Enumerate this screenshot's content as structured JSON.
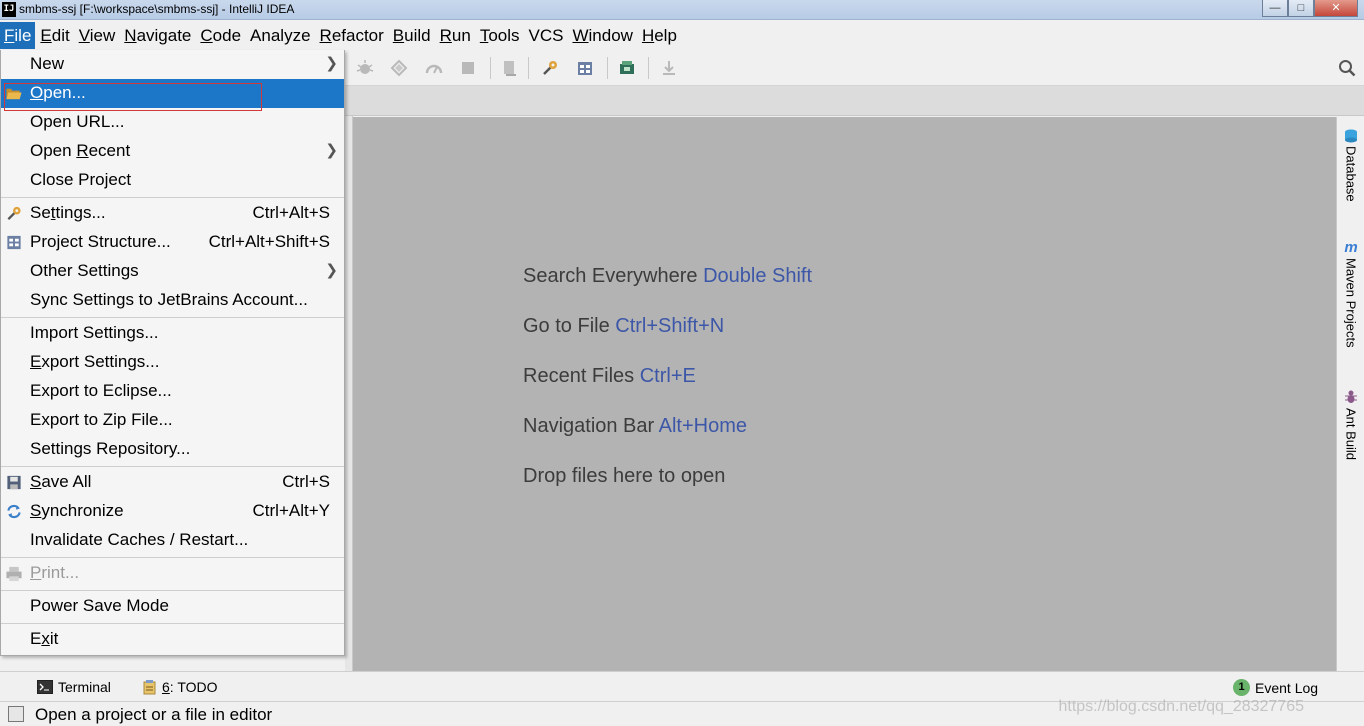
{
  "window": {
    "title": "smbms-ssj [F:\\workspace\\smbms-ssj] - IntelliJ IDEA",
    "app_icon": "IJ",
    "buttons": {
      "minimize": "—",
      "maximize": "□",
      "close": "✕"
    }
  },
  "menubar": [
    {
      "label": "File",
      "mn": "F",
      "rest": "ile",
      "active": true
    },
    {
      "label": "Edit",
      "mn": "E",
      "rest": "dit"
    },
    {
      "label": "View",
      "mn": "V",
      "rest": "iew"
    },
    {
      "label": "Navigate",
      "mn": "N",
      "rest": "avigate"
    },
    {
      "label": "Code",
      "mn": "C",
      "rest": "ode"
    },
    {
      "label": "Analyze",
      "mn": "",
      "rest": "Analyze"
    },
    {
      "label": "Refactor",
      "mn": "R",
      "rest": "efactor"
    },
    {
      "label": "Build",
      "mn": "B",
      "rest": "uild"
    },
    {
      "label": "Run",
      "mn": "R",
      "rest": "un"
    },
    {
      "label": "Tools",
      "mn": "T",
      "rest": "ools"
    },
    {
      "label": "VCS",
      "mn": "",
      "rest": "VCS"
    },
    {
      "label": "Window",
      "mn": "W",
      "rest": "indow"
    },
    {
      "label": "Help",
      "mn": "H",
      "rest": "elp"
    }
  ],
  "file_menu": {
    "items": [
      {
        "label": "New",
        "submenu": true
      },
      {
        "label": "Open...",
        "selected": true,
        "icon": "folder-open-icon"
      },
      {
        "label": "Open URL..."
      },
      {
        "label": "Open Recent",
        "submenu": true
      },
      {
        "label": "Close Project"
      },
      {
        "label": "Settings...",
        "shortcut": "Ctrl+Alt+S",
        "icon": "wrench-icon"
      },
      {
        "label": "Project Structure...",
        "shortcut": "Ctrl+Alt+Shift+S",
        "icon": "project-structure-icon"
      },
      {
        "label": "Other Settings",
        "submenu": true
      },
      {
        "label": "Sync Settings to JetBrains Account..."
      },
      {
        "label": "Import Settings..."
      },
      {
        "label": "Export Settings..."
      },
      {
        "label": "Export to Eclipse..."
      },
      {
        "label": "Export to Zip File..."
      },
      {
        "label": "Settings Repository..."
      },
      {
        "label": "Save All",
        "shortcut": "Ctrl+S",
        "icon": "save-icon"
      },
      {
        "label": "Synchronize",
        "shortcut": "Ctrl+Alt+Y",
        "icon": "sync-icon"
      },
      {
        "label": "Invalidate Caches / Restart..."
      },
      {
        "label": "Print...",
        "disabled": true,
        "icon": "print-icon"
      },
      {
        "label": "Power Save Mode"
      },
      {
        "label": "Exit"
      }
    ]
  },
  "editor": {
    "hints": [
      {
        "text": "Search Everywhere",
        "key": "Double Shift"
      },
      {
        "text": "Go to File",
        "key": "Ctrl+Shift+N"
      },
      {
        "text": "Recent Files",
        "key": "Ctrl+E"
      },
      {
        "text": "Navigation Bar",
        "key": "Alt+Home"
      },
      {
        "text": "Drop files here to open",
        "key": ""
      }
    ]
  },
  "right_tools": [
    {
      "label": "Database",
      "icon": "database-icon"
    },
    {
      "label": "Maven Projects",
      "icon": "maven-icon"
    },
    {
      "label": "Ant Build",
      "icon": "ant-icon"
    }
  ],
  "bottom_tools": {
    "terminal": "Terminal",
    "todo_num": "6",
    "todo_rest": ": TODO",
    "event_log": "Event Log",
    "event_count": "1"
  },
  "status": {
    "message": "Open a project or a file in editor"
  },
  "watermark": "https://blog.csdn.net/qq_28327765",
  "colors": {
    "selection": "#1c77c9",
    "editor_bg": "#b3b3b3",
    "hint_key": "#3d57a8",
    "annotation_box": "#d23a3a"
  }
}
